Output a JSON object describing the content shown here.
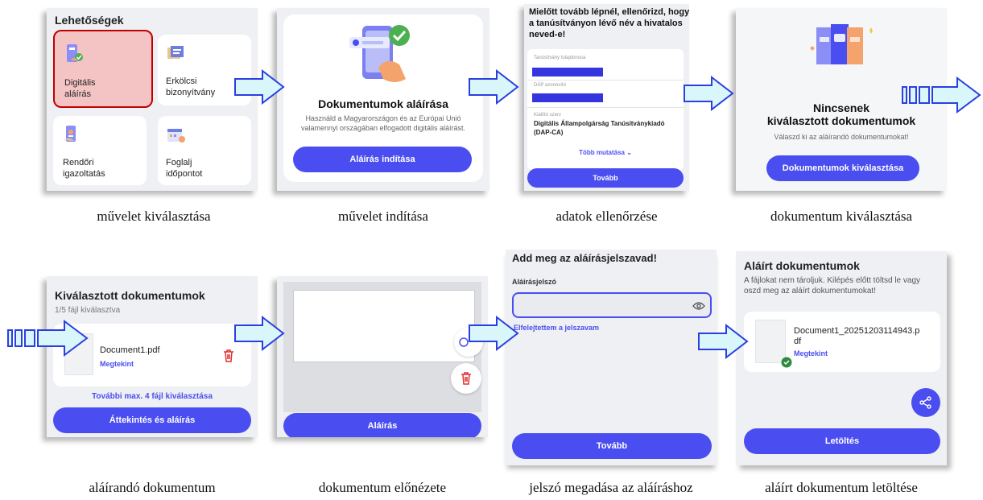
{
  "step1": {
    "title": "Lehetőségek",
    "tiles": [
      {
        "label1": "Digitális",
        "label2": "aláírás",
        "icon": "phone-sign-icon"
      },
      {
        "label1": "Erkölcsi",
        "label2": "bizonyítvány",
        "icon": "certificate-icon"
      },
      {
        "label1": "Rendőri",
        "label2": "igazoltatás",
        "icon": "police-id-icon"
      },
      {
        "label1": "Foglalj",
        "label2": "időpontot",
        "icon": "calendar-icon"
      }
    ],
    "caption": "művelet kiválasztása"
  },
  "step2": {
    "title": "Dokumentumok aláírása",
    "desc1": "Használd a Magyarországon és az Európai Unió",
    "desc2": "valamennyi országában elfogadott digitális aláírást.",
    "button": "Aláírás indítása",
    "caption": "művelet indítása"
  },
  "step3": {
    "heading1": "Mielőtt tovább lépnél, ellenőrizd, hogy",
    "heading2": "a tanúsítványon lévő név a hivatalos",
    "heading3": "neved-e!",
    "field1_label": "Tanúsítvány tulajdonosa",
    "field2_label": "DÁP azonosító",
    "field3_label": "Kiállító szerv",
    "field3_value1": "Digitális Állampolgárság Tanúsítványkiadó",
    "field3_value2": "(DAP-CA)",
    "more": "Több mutatása",
    "button": "Tovább",
    "caption": "adatok ellenőrzése"
  },
  "step4": {
    "title1": "Nincsenek",
    "title2": "kiválasztott dokumentumok",
    "desc": "Válaszd ki az aláírandó dokumentumokat!",
    "button": "Dokumentumok kiválasztása",
    "caption": "dokumentum kiválasztása"
  },
  "step5": {
    "title": "Kiválasztott dokumentumok",
    "count": "1/5 fájl kiválasztva",
    "file_name": "Document1.pdf",
    "view": "Megtekint",
    "more": "További max. 4 fájl kiválasztása",
    "button": "Áttekintés és aláírás",
    "caption": "aláírandó dokumentum"
  },
  "step6": {
    "button": "Aláírás",
    "caption": "dokumentum előnézete"
  },
  "step7": {
    "title": "Add meg az aláírásjelszavad!",
    "label": "Aláírásjelszó",
    "forgot": "Elfelejtettem a jelszavam",
    "button": "Tovább",
    "caption": "jelszó megadása az aláíráshoz"
  },
  "step8": {
    "title": "Aláírt dokumentumok",
    "desc1": "A fájlokat nem tároljuk. Kilépés előtt töltsd le vagy",
    "desc2": "oszd meg az aláírt dokumentumokat!",
    "file_name1": "Document1_20251203114943.p",
    "file_name2": "df",
    "view": "Megtekint",
    "button": "Letöltés",
    "caption": "aláírt dokumentum letöltése"
  },
  "colors": {
    "accent": "#4a4ef0",
    "highlight": "#f4c4c4",
    "highlight_border": "#c00000",
    "arrow_fill": "#d9f7fb",
    "arrow_stroke": "#2b3fe0",
    "redact": "#3535e0",
    "delete": "#e03030",
    "check": "#2e8b3e"
  }
}
